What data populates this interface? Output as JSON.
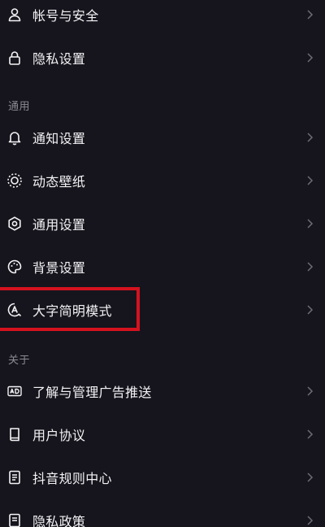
{
  "colors": {
    "background": "#16151d",
    "text_primary": "#f3f3f5",
    "text_secondary": "#8b8a93",
    "chevron": "#6e6d76",
    "highlight_border": "#d5121f"
  },
  "sections": [
    {
      "header": "",
      "items": [
        {
          "label": "帐号与安全",
          "icon": "person-icon"
        },
        {
          "label": "隐私设置",
          "icon": "lock-icon"
        }
      ]
    },
    {
      "header": "通用",
      "items": [
        {
          "label": "通知设置",
          "icon": "bell-icon"
        },
        {
          "label": "动态壁纸",
          "icon": "dynamic-wallpaper-icon"
        },
        {
          "label": "通用设置",
          "icon": "gear-icon"
        },
        {
          "label": "背景设置",
          "icon": "palette-icon"
        },
        {
          "label": "大字简明模式",
          "icon": "large-text-mode-icon",
          "highlighted": true
        }
      ]
    },
    {
      "header": "关于",
      "items": [
        {
          "label": "了解与管理广告推送",
          "icon": "ad-icon"
        },
        {
          "label": "用户协议",
          "icon": "book-icon"
        },
        {
          "label": "抖音规则中心",
          "icon": "rules-document-icon"
        },
        {
          "label": "隐私政策",
          "icon": "privacy-policy-icon"
        }
      ]
    }
  ]
}
